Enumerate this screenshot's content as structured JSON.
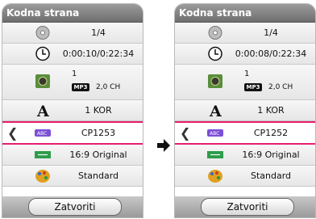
{
  "panels": [
    {
      "title": "Kodna strana",
      "rows": [
        {
          "icon": "disc-icon",
          "value": "1/4"
        },
        {
          "icon": "clock-icon",
          "value": "0:00:10/0:22:34"
        },
        {
          "icon": "speaker-icon",
          "value": "1",
          "badge": "MP3",
          "channels": "2,0 CH"
        },
        {
          "icon": "font-a-icon",
          "value": "1 KOR"
        },
        {
          "icon": "abc-subtitle-icon",
          "value": "CP1253"
        },
        {
          "icon": "aspect-ratio-icon",
          "value": "16:9 Original"
        },
        {
          "icon": "palette-icon",
          "value": "Standard"
        }
      ],
      "button": "Zatvoriti"
    },
    {
      "title": "Kodna strana",
      "rows": [
        {
          "icon": "disc-icon",
          "value": "1/4"
        },
        {
          "icon": "clock-icon",
          "value": "0:00:08/0:22:34"
        },
        {
          "icon": "speaker-icon",
          "value": "1",
          "badge": "MP3",
          "channels": "2,0 CH"
        },
        {
          "icon": "font-a-icon",
          "value": "1 KOR"
        },
        {
          "icon": "abc-subtitle-icon",
          "value": "CP1252"
        },
        {
          "icon": "aspect-ratio-icon",
          "value": "16:9 Original"
        },
        {
          "icon": "palette-icon",
          "value": "Standard"
        }
      ],
      "button": "Zatvoriti"
    }
  ],
  "colors": {
    "selection": "#e61e6e",
    "title_bar": "#7a7a7a"
  }
}
